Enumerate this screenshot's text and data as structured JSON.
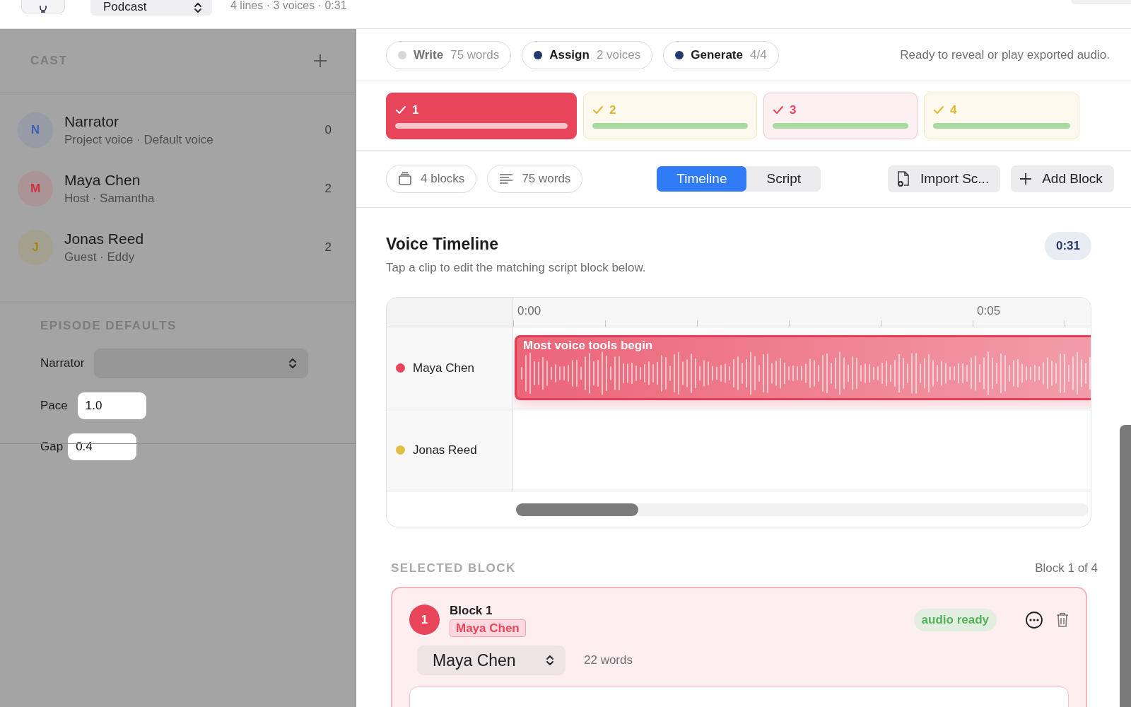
{
  "top_bar": {
    "project_type": "Podcast",
    "summary": "4 lines · 3 voices · 0:31"
  },
  "sidebar": {
    "cast_title": "CAST",
    "cast": [
      {
        "initial": "N",
        "name": "Narrator",
        "detail": "Project voice · Default voice",
        "count": "0",
        "color": "#3d5fb5"
      },
      {
        "initial": "M",
        "name": "Maya Chen",
        "detail": "Host · Samantha",
        "count": "2",
        "color": "#d0303f"
      },
      {
        "initial": "J",
        "name": "Jonas Reed",
        "detail": "Guest · Eddy",
        "count": "2",
        "color": "#a8860c"
      }
    ],
    "defaults_title": "EPISODE DEFAULTS",
    "defaults": [
      {
        "kind": "select",
        "label": "Narrator"
      },
      {
        "kind": "input",
        "label": "Pace",
        "value": "1.0"
      },
      {
        "kind": "input",
        "label": "Gap",
        "value": "0.4"
      }
    ]
  },
  "steps": [
    {
      "label": "Write",
      "detail": "75 words",
      "enabled": false
    },
    {
      "label": "Assign",
      "detail": "2 voices",
      "enabled": true
    },
    {
      "label": "Generate",
      "detail": "4/4",
      "enabled": true
    }
  ],
  "status": "Ready to reveal or play exported audio.",
  "blocks": [
    {
      "label": "1",
      "color": "#e8445a",
      "selected": true,
      "level": 1
    },
    {
      "label": "2",
      "color": "#e0b830",
      "selected": false,
      "level": 1
    },
    {
      "label": "3",
      "color": "#e8445a",
      "selected": false,
      "level": 1
    },
    {
      "label": "4",
      "color": "#e0b830",
      "selected": false,
      "level": 1
    }
  ],
  "toolbar": {
    "blocks": "4 blocks",
    "words": "75 words",
    "views": [
      {
        "label": "Timeline",
        "selected": true
      },
      {
        "label": "Script",
        "selected": false
      }
    ],
    "import": "Import Sc...",
    "add": "Add Block"
  },
  "timeline": {
    "title": "Voice Timeline",
    "subtitle": "Tap a clip to edit the matching script block below.",
    "duration": "0:31",
    "ruler": [
      "0:00",
      "0:05"
    ],
    "tracks": [
      {
        "name": "Maya Chen",
        "color": "#e8445a",
        "clip": "Most voice tools begin"
      },
      {
        "name": "Jonas Reed",
        "color": "#e0c040"
      }
    ]
  },
  "selected_block": {
    "heading": "SELECTED BLOCK",
    "position": "Block 1 of 4",
    "number": "1",
    "title": "Block 1",
    "speaker": "Maya Chen",
    "status": "audio ready",
    "voice": "Maya Chen",
    "words": "22 words",
    "color": "#e8445a"
  }
}
